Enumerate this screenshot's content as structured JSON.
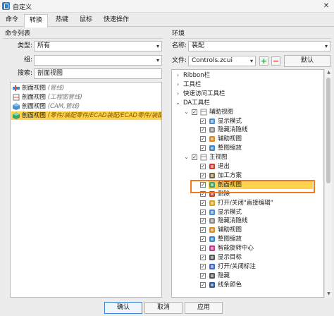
{
  "window": {
    "title": "自定义",
    "close_glyph": "✕"
  },
  "tabs": [
    "命令",
    "转换",
    "热键",
    "鼠标",
    "快速操作"
  ],
  "active_tab": 1,
  "left": {
    "header": "命令列表",
    "type_label": "类型:",
    "type_value": "所有",
    "group_label": "组:",
    "group_value": "",
    "search_label": "搜索:",
    "search_value": "剖面视图",
    "items": [
      {
        "name": "剖面视图",
        "hint": "(管线)"
      },
      {
        "name": "剖面视图",
        "hint": "(工程图管线)"
      },
      {
        "name": "剖面视图",
        "hint": "(CAM,管线)"
      },
      {
        "name": "剖面视图",
        "hint": "(零件/装配零件/ECAD装配/ECAD零件/装配",
        "selected": true
      }
    ]
  },
  "right": {
    "header": "环境",
    "name_label": "名称:",
    "name_value": "装配",
    "file_label": "文件:",
    "file_value": "Controls.zcui",
    "add_glyph": "+",
    "remove_glyph": "−",
    "default_label": "默认",
    "tree": [
      {
        "label": "Ribbon栏",
        "indent": 0,
        "expand": ">"
      },
      {
        "label": "工具栏",
        "indent": 0,
        "expand": ">"
      },
      {
        "label": "快速访问工具栏",
        "indent": 0,
        "expand": ">"
      },
      {
        "label": "DA工具栏",
        "indent": 0,
        "expand": "v"
      },
      {
        "label": "辅助视图",
        "indent": 1,
        "expand": "v",
        "check": true
      },
      {
        "label": "显示模式",
        "indent": 2,
        "check": true,
        "icon": "display-mode"
      },
      {
        "label": "隐藏消隐线",
        "indent": 2,
        "check": true,
        "icon": "hidden-line"
      },
      {
        "label": "辅助视图",
        "indent": 2,
        "check": true,
        "icon": "aux-view"
      },
      {
        "label": "整图缩放",
        "indent": 2,
        "check": true,
        "icon": "zoom-all"
      },
      {
        "label": "主视图",
        "indent": 1,
        "expand": "v",
        "check": true
      },
      {
        "label": "退出",
        "indent": 2,
        "check": true,
        "icon": "exit"
      },
      {
        "label": "加工方案",
        "indent": 2,
        "check": true,
        "icon": "machining"
      },
      {
        "label": "剖面视图",
        "indent": 2,
        "check": true,
        "icon": "section-view",
        "selected": true
      },
      {
        "label": "删除",
        "indent": 2,
        "check": true,
        "icon": "delete"
      },
      {
        "label": "打开/关闭\"直接编辑\"",
        "indent": 2,
        "check": true,
        "icon": "direct-edit"
      },
      {
        "label": "显示模式",
        "indent": 2,
        "check": true,
        "icon": "display-mode"
      },
      {
        "label": "隐藏消隐线",
        "indent": 2,
        "check": true,
        "icon": "hidden-line"
      },
      {
        "label": "辅助视图",
        "indent": 2,
        "check": true,
        "icon": "aux-view"
      },
      {
        "label": "整图缩放",
        "indent": 2,
        "check": true,
        "icon": "zoom-all"
      },
      {
        "label": "智能旋转中心",
        "indent": 2,
        "check": true,
        "icon": "smart-rotate"
      },
      {
        "label": "显示目标",
        "indent": 2,
        "check": true,
        "icon": "show-target"
      },
      {
        "label": "打开/关闭标注",
        "indent": 2,
        "check": true,
        "icon": "toggle-dims"
      },
      {
        "label": "隐藏",
        "indent": 2,
        "check": true,
        "icon": "hide"
      },
      {
        "label": "线条颜色",
        "indent": 2,
        "check": true,
        "icon": "line-color"
      }
    ]
  },
  "buttons": {
    "ok": "确认",
    "cancel": "取消",
    "apply": "应用"
  },
  "colors": {
    "selection": "#ffd24d",
    "highlight_frame": "#f07b1d",
    "accent": "#3b83d1"
  }
}
